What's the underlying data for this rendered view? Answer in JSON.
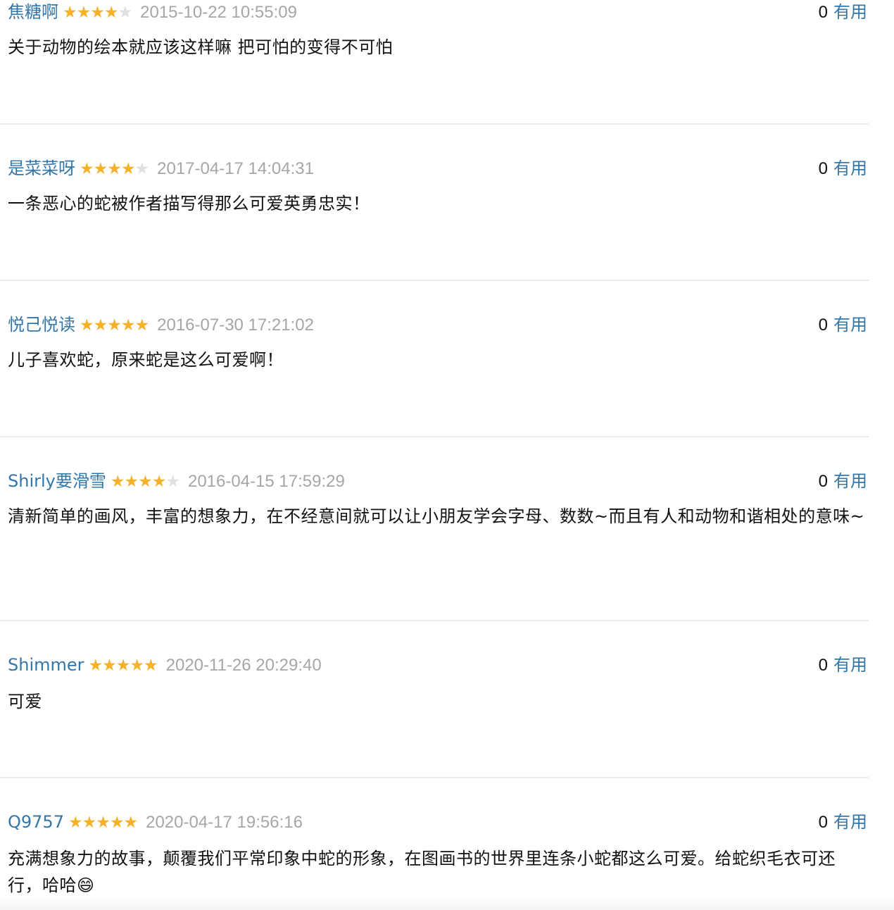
{
  "comments": [
    {
      "author": "焦糖啊",
      "rating": 4,
      "time": "2015-10-22 10:55:09",
      "votes": "0",
      "vote_label": "有用",
      "content": "关于动物的绘本就应该这样嘛 把可怕的变得不可怕"
    },
    {
      "author": "是菜菜呀",
      "rating": 4,
      "time": "2017-04-17 14:04:31",
      "votes": "0",
      "vote_label": "有用",
      "content": "一条恶心的蛇被作者描写得那么可爱英勇忠实！"
    },
    {
      "author": "悦己悦读",
      "rating": 5,
      "time": "2016-07-30 17:21:02",
      "votes": "0",
      "vote_label": "有用",
      "content": "儿子喜欢蛇，原来蛇是这么可爱啊！"
    },
    {
      "author": "Shirly要滑雪",
      "rating": 4,
      "time": "2016-04-15 17:59:29",
      "votes": "0",
      "vote_label": "有用",
      "content": "清新简单的画风，丰富的想象力，在不经意间就可以让小朋友学会字母、数数~而且有人和动物和谐相处的意味~"
    },
    {
      "author": "Shimmer",
      "rating": 5,
      "time": "2020-11-26 20:29:40",
      "votes": "0",
      "vote_label": "有用",
      "content": "可爱"
    },
    {
      "author": "Q9757",
      "rating": 5,
      "time": "2020-04-17 19:56:16",
      "votes": "0",
      "vote_label": "有用",
      "content": "充满想象力的故事，颠覆我们平常印象中蛇的形象，在图画书的世界里连条小蛇都这么可爱。给蛇织毛衣可还行，哈哈😄"
    }
  ],
  "colors": {
    "link": "#3377aa",
    "star_on": "#f7b129",
    "star_off": "#e0e0e0",
    "time": "#a6a6a6",
    "divider": "#ebebeb"
  }
}
